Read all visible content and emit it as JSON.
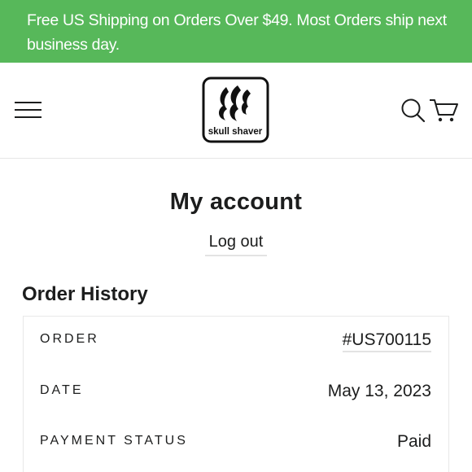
{
  "announcement": {
    "text": "Free US Shipping on Orders Over $49. Most Orders ship next business day."
  },
  "header": {
    "menu_icon": "hamburger-menu-icon",
    "logo_text": "skull shaver",
    "search_icon": "search-icon",
    "cart_icon": "cart-icon"
  },
  "account": {
    "title": "My account",
    "logout_label": "Log out"
  },
  "order_history": {
    "title": "Order History",
    "order_label": "ORDER",
    "order_number": "#US700115",
    "date_label": "DATE",
    "date_value": "May 13, 2023",
    "payment_status_label": "PAYMENT STATUS",
    "payment_status_value": "Paid"
  },
  "colors": {
    "announcement_bg": "#57b85a",
    "text": "#1c1d1d"
  }
}
